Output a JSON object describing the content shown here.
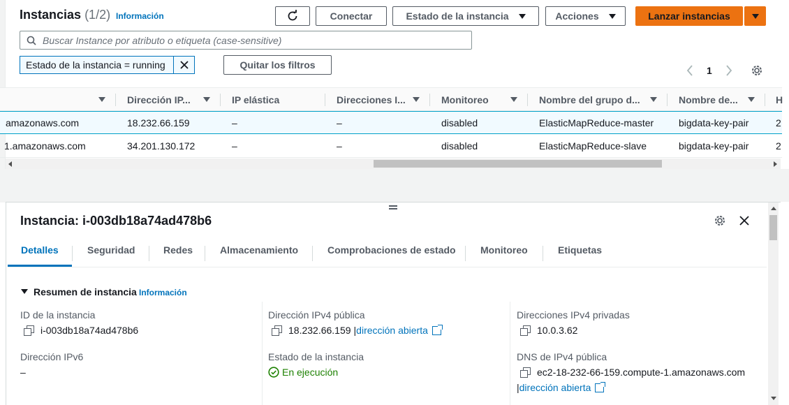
{
  "header": {
    "title": "Instancias",
    "count": "(1/2)",
    "info": "Información",
    "connect": "Conectar",
    "instance_state": "Estado de la instancia",
    "actions": "Acciones",
    "launch": "Lanzar instancias"
  },
  "search": {
    "placeholder": "Buscar Instance por atributo o etiqueta (case-sensitive)"
  },
  "filter": {
    "token": "Estado de la instancia = running",
    "clear": "Quitar los filtros"
  },
  "pagination": {
    "page": "1"
  },
  "table": {
    "columns": [
      "Dirección IP...",
      "IP elástica",
      "Direcciones I...",
      "Monitoreo",
      "Nombre del grupo d...",
      "Nombre de...",
      "H"
    ],
    "rows": [
      {
        "dns": "amazonaws.com",
        "ip": "18.232.66.159",
        "eip": "–",
        "addr": "–",
        "mon": "disabled",
        "sg": "ElasticMapReduce-master",
        "key": "bigdata-key-pair",
        "extra": "2"
      },
      {
        "dns": "1.amazonaws.com",
        "ip": "34.201.130.172",
        "eip": "–",
        "addr": "–",
        "mon": "disabled",
        "sg": "ElasticMapReduce-slave",
        "key": "bigdata-key-pair",
        "extra": "2"
      }
    ]
  },
  "detail": {
    "title": "Instancia: i-003db18a74ad478b6",
    "tabs": [
      "Detalles",
      "Seguridad",
      "Redes",
      "Almacenamiento",
      "Comprobaciones de estado",
      "Monitoreo",
      "Etiquetas"
    ],
    "section": "Resumen de instancia",
    "section_info": "Información",
    "fields": {
      "id_label": "ID de la instancia",
      "id_value": "i-003db18a74ad478b6",
      "ipv4_pub_label": "Dirección IPv4 pública",
      "ipv4_pub_value": "18.232.66.159",
      "open_link": "dirección abierta",
      "ipv4_priv_label": "Direcciones IPv4 privadas",
      "ipv4_priv_value": "10.0.3.62",
      "ipv6_label": "Dirección IPv6",
      "ipv6_value": "–",
      "state_label": "Estado de la instancia",
      "state_value": "En ejecución",
      "dns_label": "DNS de IPv4 pública",
      "dns_value": "ec2-18-232-66-159.compute-1.amazonaws.com",
      "dns_link": "dirección abierta"
    }
  },
  "colors": {
    "accent": "#ec7211",
    "link": "#0073bb",
    "success": "#1d8102"
  }
}
